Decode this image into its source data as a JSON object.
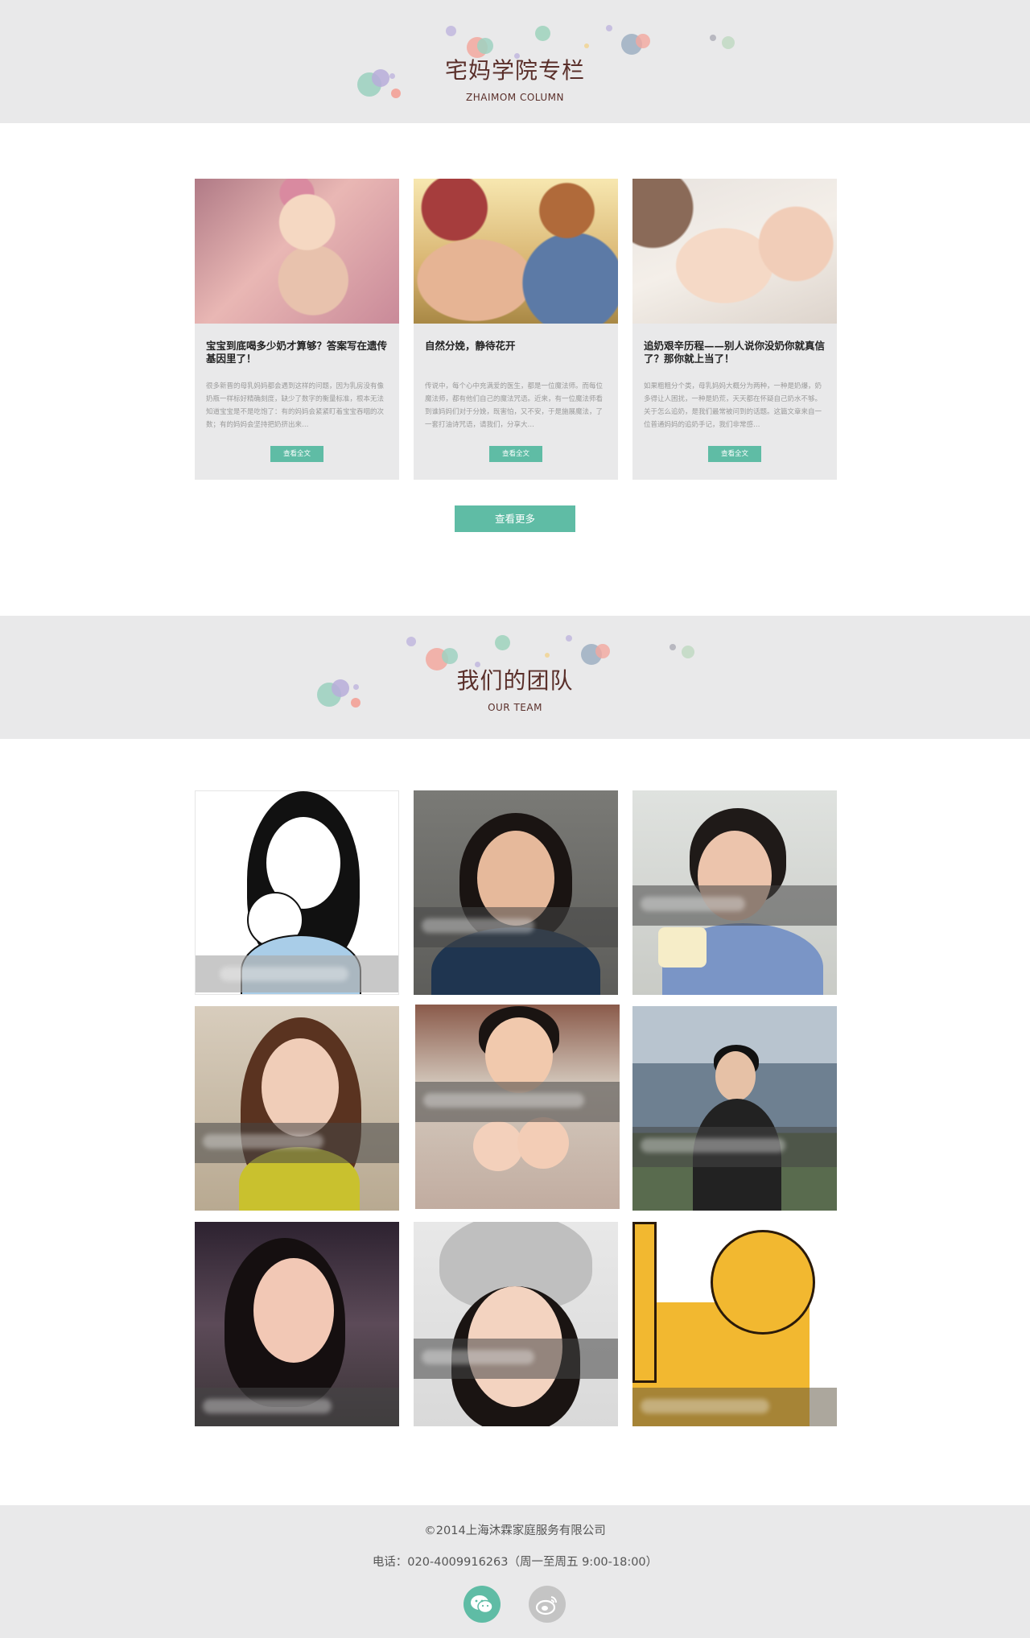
{
  "column": {
    "title": "宅妈学院专栏",
    "subtitle": "ZHAIMOM COLUMN"
  },
  "articles": [
    {
      "title": "宝宝到底喝多少奶才算够？答案写在遗传基因里了！",
      "excerpt": "很多新晋的母乳妈妈都会遇到这样的问题，因为乳房没有像奶瓶一样标好精确刻度，缺少了数字的衡量标准，根本无法知道宝宝是不是吃饱了：有的妈妈会紧紧盯着宝宝吞咽的次数；有的妈妈会坚持把奶挤出来…",
      "button": "查看全文",
      "image": "mother-breastfeeding-flower-crown-photo"
    },
    {
      "title": "自然分娩，静待花开",
      "excerpt": "传说中，每个心中充满爱的医生，都是一位魔法师。而每位魔法师，都有他们自己的魔法咒语。近来，有一位魔法师看到谁妈妈们对于分娩，既害怕，又不安，于是施展魔法，了一套打油诗咒语，请我们，分享大…",
      "button": "查看全文",
      "image": "pregnant-belly-and-child-photo"
    },
    {
      "title": "追奶艰辛历程——别人说你没奶你就真信了？那你就上当了！",
      "excerpt": "如果粗粗分个类，母乳妈妈大概分为两种，一种是奶爆，奶多得让人困扰，一种是奶荒，天天都在怀疑自己奶水不够。关于怎么追奶，是我们最常被问到的话题。这篇文章来自一位普通妈妈的追奶手记，我们非常感…",
      "button": "查看全文",
      "image": "sleeping-baby-photo"
    }
  ],
  "more_button": "查看更多",
  "team": {
    "title": "我们的团队",
    "subtitle": "OUR TEAM",
    "members": [
      {
        "image": "cartoon-mother-and-daughter-avatar"
      },
      {
        "image": "team-member-photo-2"
      },
      {
        "image": "team-member-photo-3"
      },
      {
        "image": "team-member-photo-4"
      },
      {
        "image": "team-member-photo-5"
      },
      {
        "image": "team-member-photo-6"
      },
      {
        "image": "team-member-photo-7"
      },
      {
        "image": "team-member-photo-8"
      },
      {
        "image": "cartoon-monkey-avatar"
      }
    ]
  },
  "footer": {
    "copyright": "©2014上海沐霖家庭服务有限公司",
    "phone": "电话：020-4009916263（周一至周五 9:00-18:00）",
    "social": [
      {
        "icon": "wechat-icon",
        "color": "#5fbca5"
      },
      {
        "icon": "weibo-icon",
        "color": "#c4c4c4"
      }
    ]
  },
  "colors": {
    "accent": "#5fbca5",
    "heading": "#5a2f2a",
    "banner_bg": "#e9e9ea"
  }
}
